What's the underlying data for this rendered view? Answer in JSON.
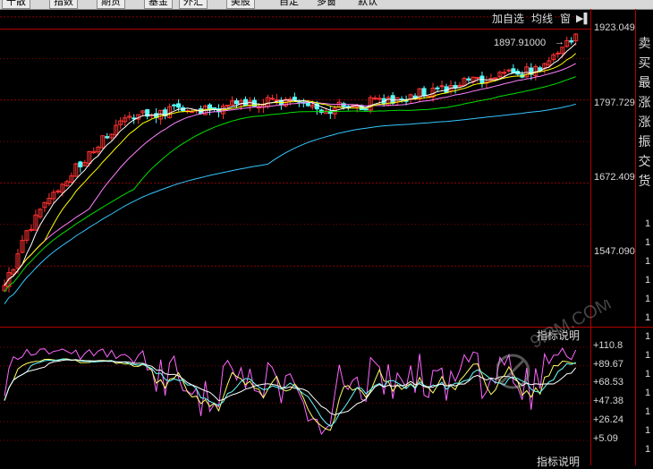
{
  "toolbar": {
    "tabs": [
      "十散",
      "指数",
      "期货",
      "基金",
      "外汇",
      "美股"
    ],
    "links": [
      "自定",
      "多窗",
      "默认"
    ]
  },
  "main": {
    "top_buttons": [
      "加自选",
      "均线",
      "窗"
    ],
    "price_axis": [
      "1923.049",
      "1797.729",
      "1672.409",
      "1547.090"
    ],
    "last_marker": "1897.91000",
    "right_panel": [
      "卖",
      "买",
      "最",
      "涨",
      "涨",
      "振",
      "交",
      "货"
    ],
    "right_digits": [
      "1",
      "1",
      "1",
      "1",
      "1",
      "1",
      "1",
      "1",
      "1",
      "1",
      "1",
      "1",
      "1"
    ]
  },
  "indicator": {
    "header": "指标说明",
    "footer_header": "指标说明",
    "axis": [
      "110.8",
      "89.67",
      "68.53",
      "47.38",
      "26.24",
      "5.09"
    ]
  },
  "watermark": "9IPM.COM",
  "colors": {
    "background": "#000000",
    "up": "#ff3232",
    "down": "#54ffff",
    "grid": "#8a0000",
    "ma5": "#ffffff",
    "ma10": "#ffff00",
    "ma20": "#ff80ff",
    "ma30": "#00e000",
    "ma60": "#36c6ff"
  }
}
